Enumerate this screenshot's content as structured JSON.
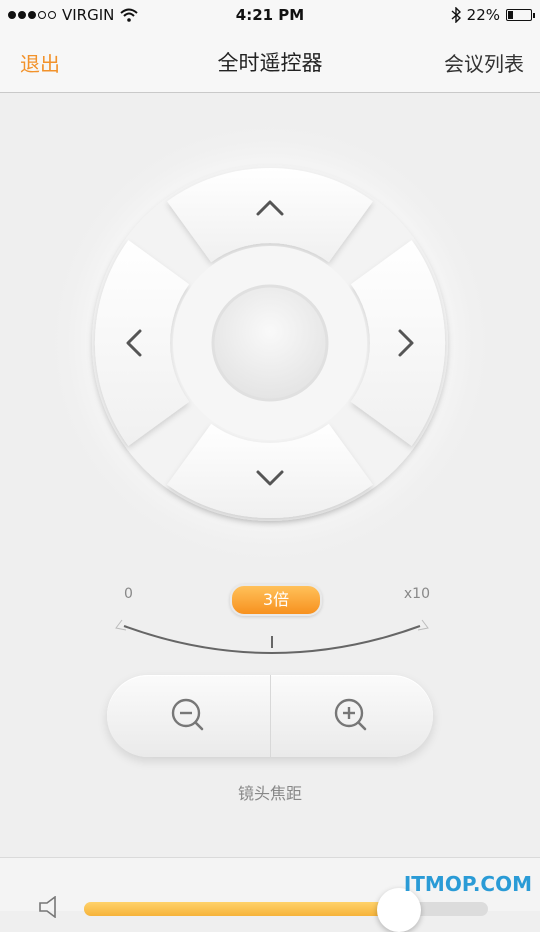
{
  "status_bar": {
    "carrier": "VIRGIN",
    "time": "4:21 PM",
    "battery_text": "22%",
    "battery_level": 0.22,
    "signal_bars_filled": 3,
    "signal_bars_total": 5
  },
  "nav": {
    "left_label": "退出",
    "title": "全时遥控器",
    "right_label": "会议列表"
  },
  "dpad": {
    "up_icon": "chevron-up-icon",
    "down_icon": "chevron-down-icon",
    "left_icon": "chevron-left-icon",
    "right_icon": "chevron-right-icon"
  },
  "zoom": {
    "min_label": "0",
    "max_label": "x10",
    "current_label": "3倍",
    "current_value": 3,
    "zoom_out_icon": "zoom-out-icon",
    "zoom_in_icon": "zoom-in-icon",
    "caption": "镜头焦距"
  },
  "volume": {
    "icon": "speaker-icon",
    "level": 0.78
  },
  "watermark": "ITMOP.COM",
  "colors": {
    "accent": "#f2922b",
    "background": "#efefef",
    "watermark": "#2a9bd6"
  }
}
